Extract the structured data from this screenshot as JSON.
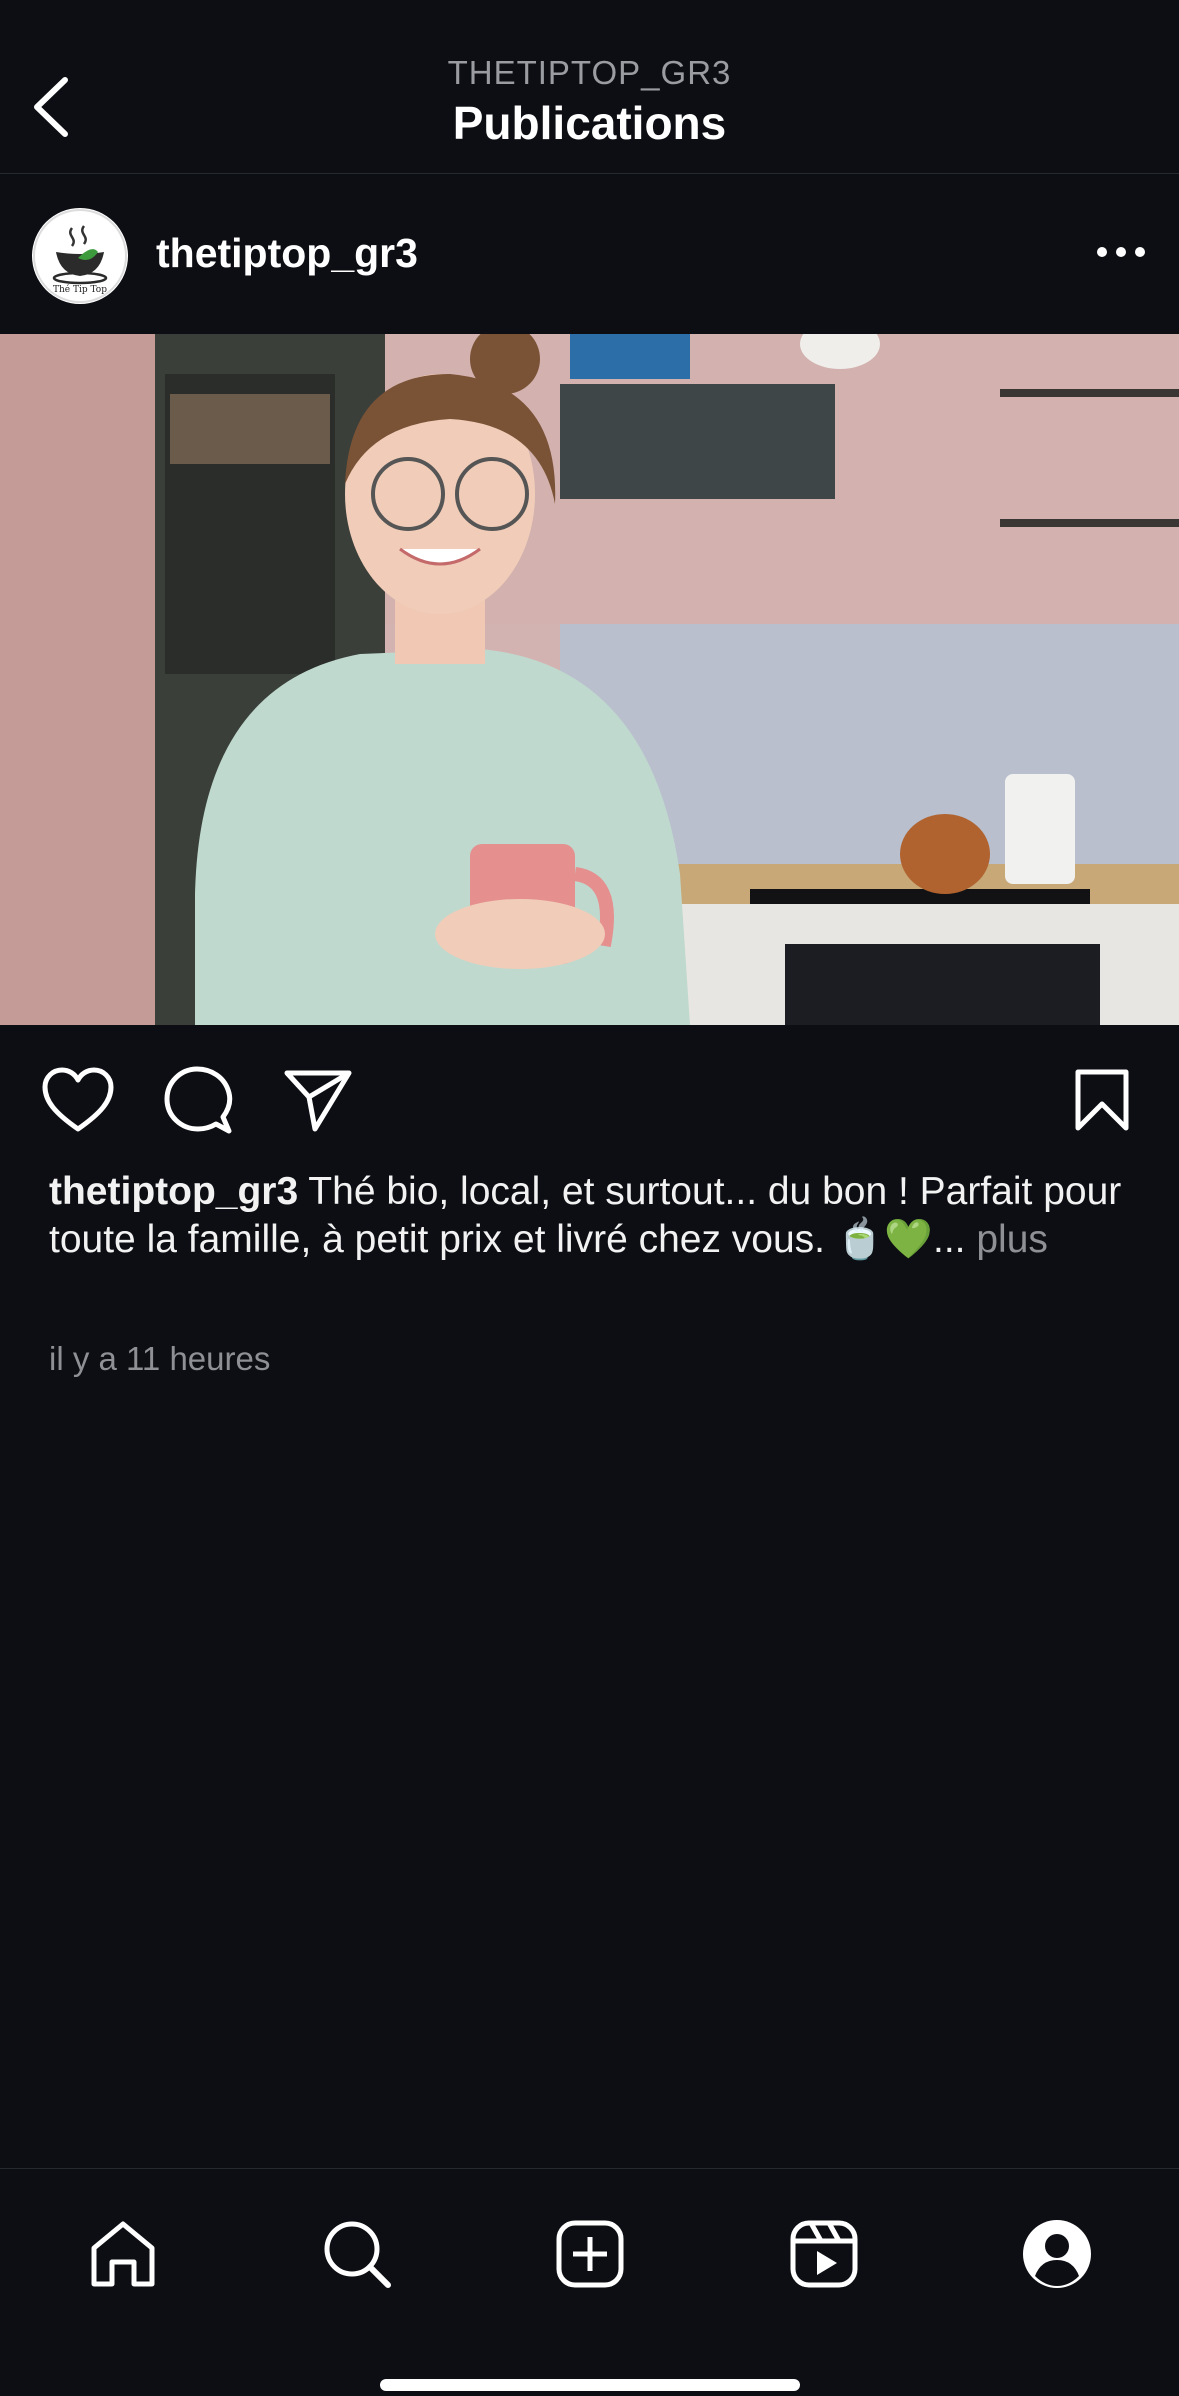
{
  "header": {
    "account": "THETIPTOP_GR3",
    "title": "Publications"
  },
  "post": {
    "username": "thetiptop_gr3",
    "avatar_logo_text": "Thé Tip Top",
    "caption_user": "thetiptop_gr3",
    "caption_text": " Thé bio, local, et surtout... du bon ! Parfait pour toute la famille, à petit prix et livré chez vous. 🍵💚",
    "caption_ellipsis": "...",
    "caption_more": " plus",
    "timestamp": "il y a 11 heures"
  },
  "icons": {
    "back": "chevron-left-icon",
    "more": "more-horizontal-icon",
    "like": "heart-icon",
    "comment": "comment-icon",
    "share": "send-icon",
    "save": "bookmark-icon",
    "nav": [
      "home-icon",
      "search-icon",
      "create-post-icon",
      "reels-icon",
      "profile-icon"
    ]
  },
  "colors": {
    "background": "#0c0e13",
    "text": "#f5f5f5",
    "muted": "#8e9096"
  }
}
